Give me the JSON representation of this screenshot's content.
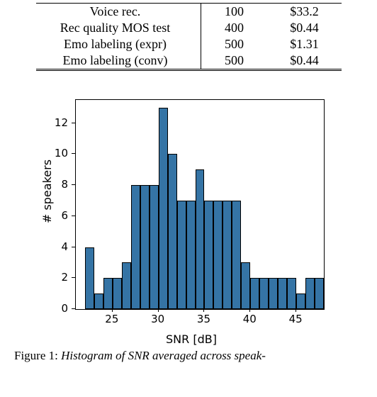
{
  "table": {
    "rows": [
      {
        "label": "Voice rec.",
        "v1": "100",
        "v2": "$33.2"
      },
      {
        "label": "Rec quality MOS test",
        "v1": "400",
        "v2": "$0.44"
      },
      {
        "label": "Emo labeling (expr)",
        "v1": "500",
        "v2": "$1.31"
      },
      {
        "label": "Emo labeling (conv)",
        "v1": "500",
        "v2": "$0.44"
      }
    ]
  },
  "chart_data": {
    "type": "bar",
    "xlabel": "SNR [dB]",
    "ylabel": "# speakers",
    "x_ticks": [
      25,
      30,
      35,
      40,
      45
    ],
    "y_ticks": [
      0,
      2,
      4,
      6,
      8,
      10,
      12
    ],
    "xlim": [
      21,
      48
    ],
    "ylim": [
      0,
      13.5
    ],
    "bin_edges": [
      22,
      23,
      24,
      25,
      26,
      27,
      28,
      29,
      30,
      31,
      32,
      33,
      34,
      35,
      36,
      37,
      38,
      39,
      40,
      41,
      42,
      43,
      44,
      45,
      46,
      47
    ],
    "values": [
      4,
      1,
      2,
      2,
      3,
      8,
      8,
      8,
      13,
      10,
      7,
      7,
      9,
      7,
      7,
      7,
      7,
      3,
      2,
      2,
      2,
      2,
      2,
      1,
      2,
      2
    ]
  },
  "caption": {
    "fig": "Figure 1: ",
    "text": "Histogram of SNR averaged across speak-"
  }
}
